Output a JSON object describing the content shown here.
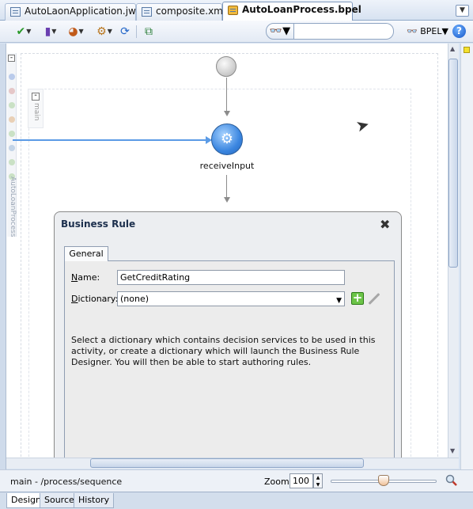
{
  "tabs": [
    {
      "label": "AutoLaonApplication.jws",
      "active": false
    },
    {
      "label": "composite.xml",
      "active": false
    },
    {
      "label": "AutoLoanProcess.bpel",
      "active": true
    }
  ],
  "toolbar": {
    "search_value": "",
    "language_label": "BPEL"
  },
  "canvas": {
    "left_label": "AutoLoanProcess",
    "sequence_label": "main",
    "activity_label": "receiveInput"
  },
  "dialog": {
    "title": "Business Rule",
    "tab_label": "General",
    "name_label_prefix": "N",
    "name_label_rest": "ame:",
    "name_value": "GetCreditRating",
    "dictionary_label_prefix": "D",
    "dictionary_label_rest": "ictionary:",
    "dictionary_value": "(none)",
    "help_text": "Select a dictionary which contains decision services to be used in this activity, or create a dictionary which will launch the Business Rule Designer. You will then be able to start authoring rules."
  },
  "status": {
    "path": "main - /process/sequence",
    "zoom_label": "Zoom:",
    "zoom_value": "100",
    "zoom_level_fraction": 0.5
  },
  "view_tabs": [
    {
      "label": "Design",
      "active": true
    },
    {
      "label": "Source",
      "active": false
    },
    {
      "label": "History",
      "active": false
    }
  ],
  "colors": {
    "accent": "#3b86e0",
    "link_line": "#5b9be6",
    "add_green": "#6cc448"
  }
}
